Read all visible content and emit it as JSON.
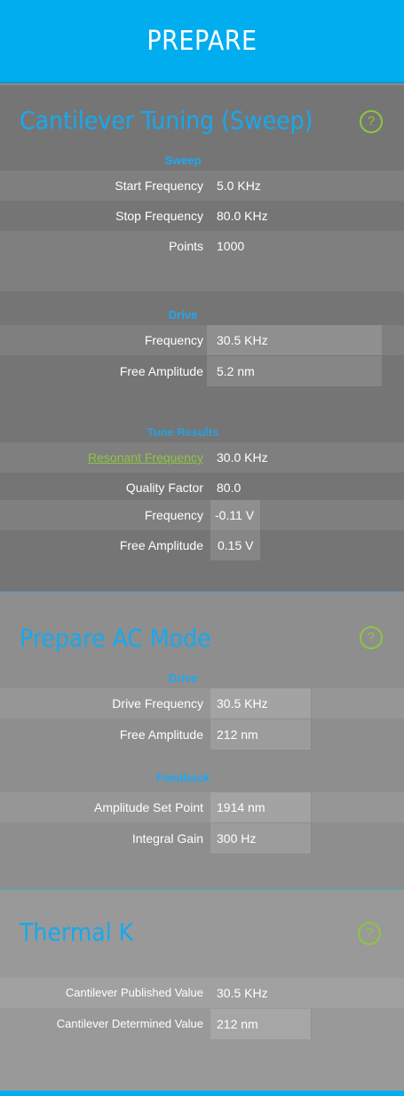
{
  "header": {
    "title": "PREPARE"
  },
  "tuning": {
    "title": "Cantilever Tuning (Sweep)",
    "help_icon": "?",
    "sweep": {
      "heading": "Sweep",
      "start_frequency": {
        "label": "Start Frequency",
        "value": "5.0 KHz"
      },
      "stop_frequency": {
        "label": "Stop Frequency",
        "value": "80.0 KHz"
      },
      "points": {
        "label": "Points",
        "value": "1000"
      }
    },
    "drive": {
      "heading": "Drive",
      "frequency": {
        "label": "Frequency",
        "value": "30.5 KHz"
      },
      "free_amplitude": {
        "label": "Free Amplitude",
        "value": "5.2 nm"
      }
    },
    "tune_results": {
      "heading": "Tune Results",
      "resonant_frequency": {
        "label": "Resonant Frequency",
        "value": "30.0 KHz"
      },
      "quality_factor": {
        "label": "Quality Factor",
        "value": "80.0"
      },
      "frequency": {
        "label": "Frequency",
        "value": "-0.11 V"
      },
      "free_amplitude": {
        "label": "Free Amplitude",
        "value": "0.15 V"
      }
    }
  },
  "ac_mode": {
    "title": "Prepare AC Mode",
    "help_icon": "?",
    "drive": {
      "heading": "Drive",
      "drive_frequency": {
        "label": "Drive Frequency",
        "value": "30.5 KHz"
      },
      "free_amplitude": {
        "label": "Free Amplitude",
        "value": "212 nm"
      }
    },
    "feedback": {
      "heading": "Feedback",
      "amplitude_set_point": {
        "label": "Amplitude Set Point",
        "value": "1914 nm"
      },
      "integral_gain": {
        "label": "Integral Gain",
        "value": "300 Hz"
      }
    }
  },
  "thermal": {
    "title": "Thermal K",
    "help_icon": "?",
    "published_value": {
      "label": "Cantilever Published Value",
      "value": "30.5 KHz"
    },
    "determined_value": {
      "label": "Cantilever Determined Value",
      "value": "212 nm"
    }
  },
  "colors": {
    "accent": "#00adef",
    "section_title": "#16a9ef",
    "help_icon": "#8dc63f",
    "link": "#8dc63f"
  }
}
